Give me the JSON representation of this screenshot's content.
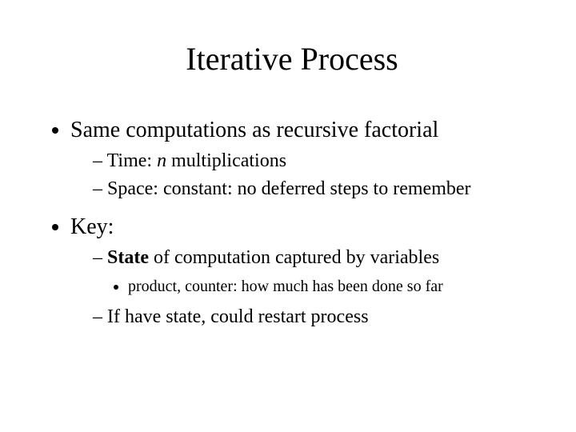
{
  "title": "Iterative Process",
  "bullets": {
    "b1": "Same computations as recursive factorial",
    "b1_1_pre": "Time: ",
    "b1_1_em": "n",
    "b1_1_post": " multiplications",
    "b1_2": "Space: constant: no deferred steps to remember",
    "b2": "Key:",
    "b2_1_strong": "State",
    "b2_1_rest": " of computation captured by variables",
    "b2_1_1": "product, counter: how much has been done so far",
    "b2_2": "If have state, could restart process"
  }
}
